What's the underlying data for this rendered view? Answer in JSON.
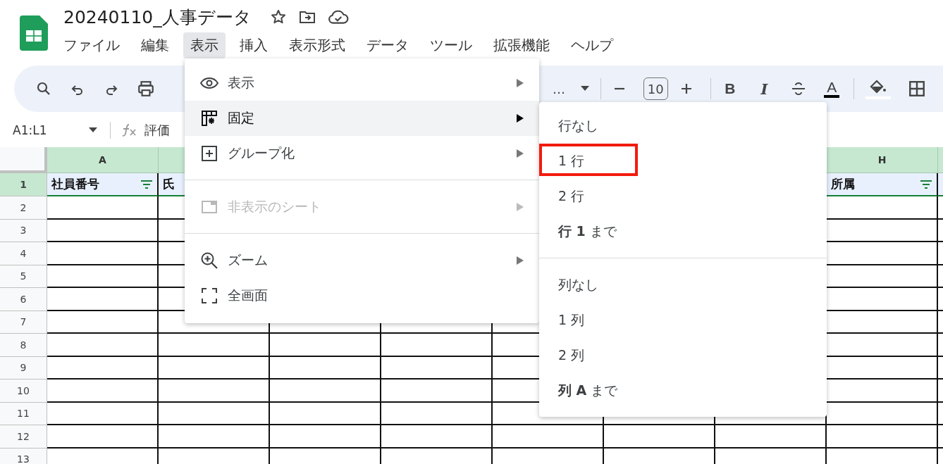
{
  "document": {
    "title": "20240110_人事データ"
  },
  "menu_bar": [
    {
      "label": "ファイル",
      "selected": false
    },
    {
      "label": "編集",
      "selected": false
    },
    {
      "label": "表示",
      "selected": true
    },
    {
      "label": "挿入",
      "selected": false
    },
    {
      "label": "表示形式",
      "selected": false
    },
    {
      "label": "データ",
      "selected": false
    },
    {
      "label": "ツール",
      "selected": false
    },
    {
      "label": "拡張機能",
      "selected": false
    },
    {
      "label": "ヘルプ",
      "selected": false
    }
  ],
  "toolbar": {
    "font": "…",
    "font_size": "10",
    "bold": "B",
    "italic": "I",
    "text_color": "A"
  },
  "formula_bar": {
    "name_box": "A1:L1",
    "formula": "評価"
  },
  "sheet": {
    "columns": [
      {
        "label": "A",
        "header": "社員番号",
        "filter": true
      },
      {
        "header": "氏"
      },
      {},
      {},
      {},
      {},
      {},
      {
        "label": "H",
        "header": "所属",
        "filter": true
      },
      {}
    ],
    "rows": [
      "1",
      "2",
      "3",
      "4",
      "5",
      "6",
      "7",
      "8",
      "9",
      "10",
      "11",
      "12",
      "13"
    ]
  },
  "view_menu": [
    {
      "kind": "item",
      "label": "表示",
      "submenu": true,
      "selected": false,
      "disabled": false
    },
    {
      "kind": "item",
      "label": "固定",
      "submenu": true,
      "selected": true,
      "disabled": false
    },
    {
      "kind": "item",
      "label": "グループ化",
      "submenu": true,
      "selected": false,
      "disabled": false
    },
    {
      "kind": "divider"
    },
    {
      "kind": "item",
      "label": "非表示のシート",
      "submenu": true,
      "selected": false,
      "disabled": true
    },
    {
      "kind": "divider"
    },
    {
      "kind": "item",
      "label": "ズーム",
      "submenu": true,
      "selected": false,
      "disabled": false
    },
    {
      "kind": "item",
      "label": "全画面",
      "submenu": false,
      "selected": false,
      "disabled": false
    }
  ],
  "freeze_submenu": [
    {
      "kind": "item",
      "label": "行なし",
      "highlighted": false
    },
    {
      "kind": "item",
      "label": "1 行",
      "highlighted": true
    },
    {
      "kind": "item",
      "label": "2 行",
      "highlighted": false
    },
    {
      "kind": "item",
      "label": "**行 1** まで",
      "highlighted": false
    },
    {
      "kind": "divider"
    },
    {
      "kind": "item",
      "label": "列なし",
      "highlighted": false
    },
    {
      "kind": "item",
      "label": "1 列",
      "highlighted": false
    },
    {
      "kind": "item",
      "label": "2 列",
      "highlighted": false
    },
    {
      "kind": "item",
      "label": "**列 A** まで",
      "highlighted": false
    }
  ]
}
